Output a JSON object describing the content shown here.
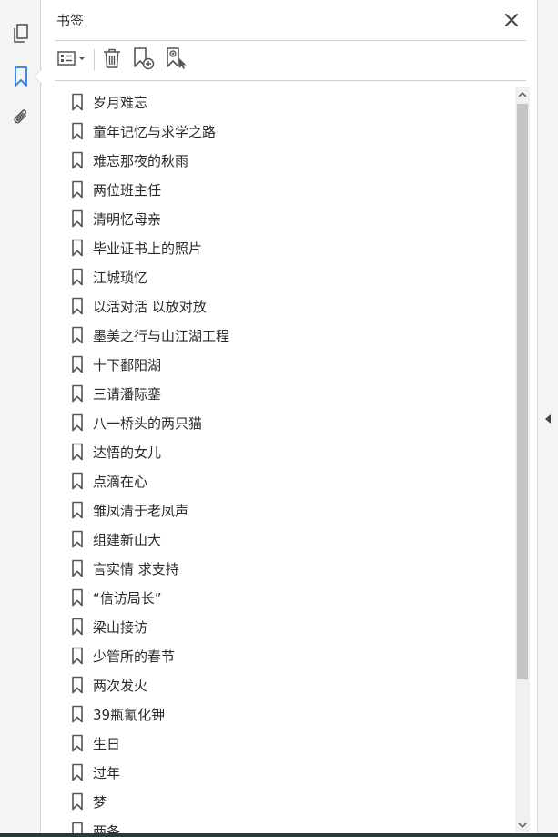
{
  "panel": {
    "title": "书签"
  },
  "rail": {
    "icons": [
      "pages-icon",
      "bookmark-icon",
      "attachment-icon"
    ],
    "accent": "#2680eb"
  },
  "toolbar": {
    "icons": [
      "options-menu-icon",
      "delete-icon",
      "new-bookmark-icon",
      "new-bookmark-from-structure-icon"
    ]
  },
  "bookmarks": [
    {
      "label": "岁月难忘"
    },
    {
      "label": "童年记忆与求学之路"
    },
    {
      "label": "难忘那夜的秋雨"
    },
    {
      "label": "两位班主任"
    },
    {
      "label": "清明忆母亲"
    },
    {
      "label": "毕业证书上的照片"
    },
    {
      "label": "江城琐忆"
    },
    {
      "label": "以活对活 以放对放"
    },
    {
      "label": "墨美之行与山江湖工程"
    },
    {
      "label": "十下鄱阳湖"
    },
    {
      "label": "三请潘际銮"
    },
    {
      "label": "八一桥头的两只猫"
    },
    {
      "label": "达悟的女儿"
    },
    {
      "label": "点滴在心"
    },
    {
      "label": "雏凤清于老凤声"
    },
    {
      "label": "组建新山大"
    },
    {
      "label": "言实情 求支持"
    },
    {
      "label": "“信访局长”"
    },
    {
      "label": "梁山接访"
    },
    {
      "label": "少管所的春节"
    },
    {
      "label": "两次发火"
    },
    {
      "label": "39瓶氰化钾"
    },
    {
      "label": "生日"
    },
    {
      "label": "过年"
    },
    {
      "label": "梦"
    },
    {
      "label": "两条"
    }
  ]
}
